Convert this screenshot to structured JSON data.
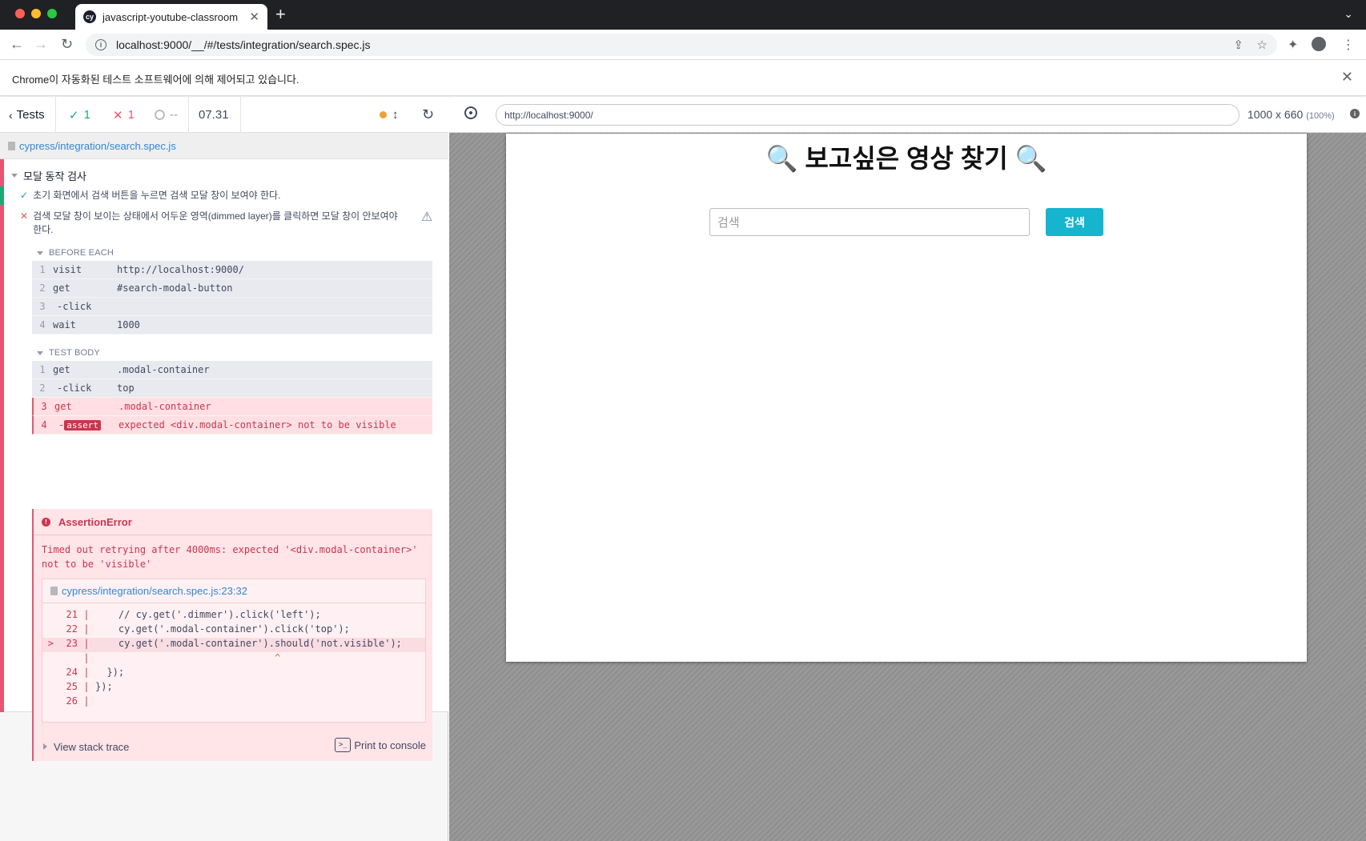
{
  "browser": {
    "tab_title": "javascript-youtube-classroom",
    "tab_favicon": "cy",
    "url": "localhost:9000/__/#/tests/integration/search.spec.js",
    "infobar_text": "Chrome이 자동화된 테스트 소프트웨어에 의해 제어되고 있습니다."
  },
  "reporter": {
    "tests_label": "Tests",
    "passed": "1",
    "failed": "1",
    "pending": "--",
    "duration": "07.31",
    "spec_path": "cypress/integration/search.spec.js",
    "suite_title": "모달 동작 검사",
    "tests": [
      {
        "status": "passed",
        "title": "초기 화면에서 검색 버튼을 누르면 검색 모달 창이 보여야 한다."
      },
      {
        "status": "failed",
        "title": "검색 모달 창이 보이는 상태에서 어두운 영역(dimmed layer)를 클릭하면 모달 창이 안보여야 한다."
      }
    ],
    "before_each": {
      "label": "BEFORE EACH",
      "commands": [
        {
          "num": "1",
          "name": "visit",
          "message": "http://localhost:9000/"
        },
        {
          "num": "2",
          "name": "get",
          "message": "#search-modal-button"
        },
        {
          "num": "3",
          "name": "-click",
          "message": ""
        },
        {
          "num": "4",
          "name": "wait",
          "message": "1000"
        }
      ]
    },
    "test_body": {
      "label": "TEST BODY",
      "commands": [
        {
          "num": "1",
          "name": "get",
          "message": ".modal-container"
        },
        {
          "num": "2",
          "name": "-click",
          "message": "top"
        },
        {
          "num": "3",
          "name": "get",
          "message": ".modal-container"
        },
        {
          "num": "4",
          "name": "-",
          "badge": "assert",
          "message": "expected <div.modal-container> not to be visible"
        }
      ]
    },
    "error": {
      "name": "AssertionError",
      "message": "Timed out retrying after 4000ms: expected '<div.modal-container>' not to be 'visible'",
      "file_link": "cypress/integration/search.spec.js:23:32",
      "code": [
        {
          "arrow": "",
          "line": "21",
          "text": "    // cy.get('.dimmer').click('left');"
        },
        {
          "arrow": "",
          "line": "22",
          "text": "    cy.get('.modal-container').click('top');"
        },
        {
          "arrow": ">",
          "line": "23",
          "text": "    cy.get('.modal-container').should('not.visible');"
        },
        {
          "arrow": "",
          "line": "",
          "text": "                               ^"
        },
        {
          "arrow": "",
          "line": "24",
          "text": "  });"
        },
        {
          "arrow": "",
          "line": "25",
          "text": "});"
        },
        {
          "arrow": "",
          "line": "26",
          "text": ""
        }
      ],
      "stack_label": "View stack trace",
      "print_label": "Print to console"
    }
  },
  "aut": {
    "url": "http://localhost:9000/",
    "size": "1000 x 660",
    "zoom": "(100%)",
    "app": {
      "title": "🔍 보고싶은 영상 찾기 🔍",
      "search_placeholder": "검색",
      "search_button": "검색"
    }
  },
  "colors": {
    "pass": "#1fa971",
    "fail": "#e45770",
    "accent_button": "#15b4cf",
    "chrome_dark": "#202124"
  }
}
